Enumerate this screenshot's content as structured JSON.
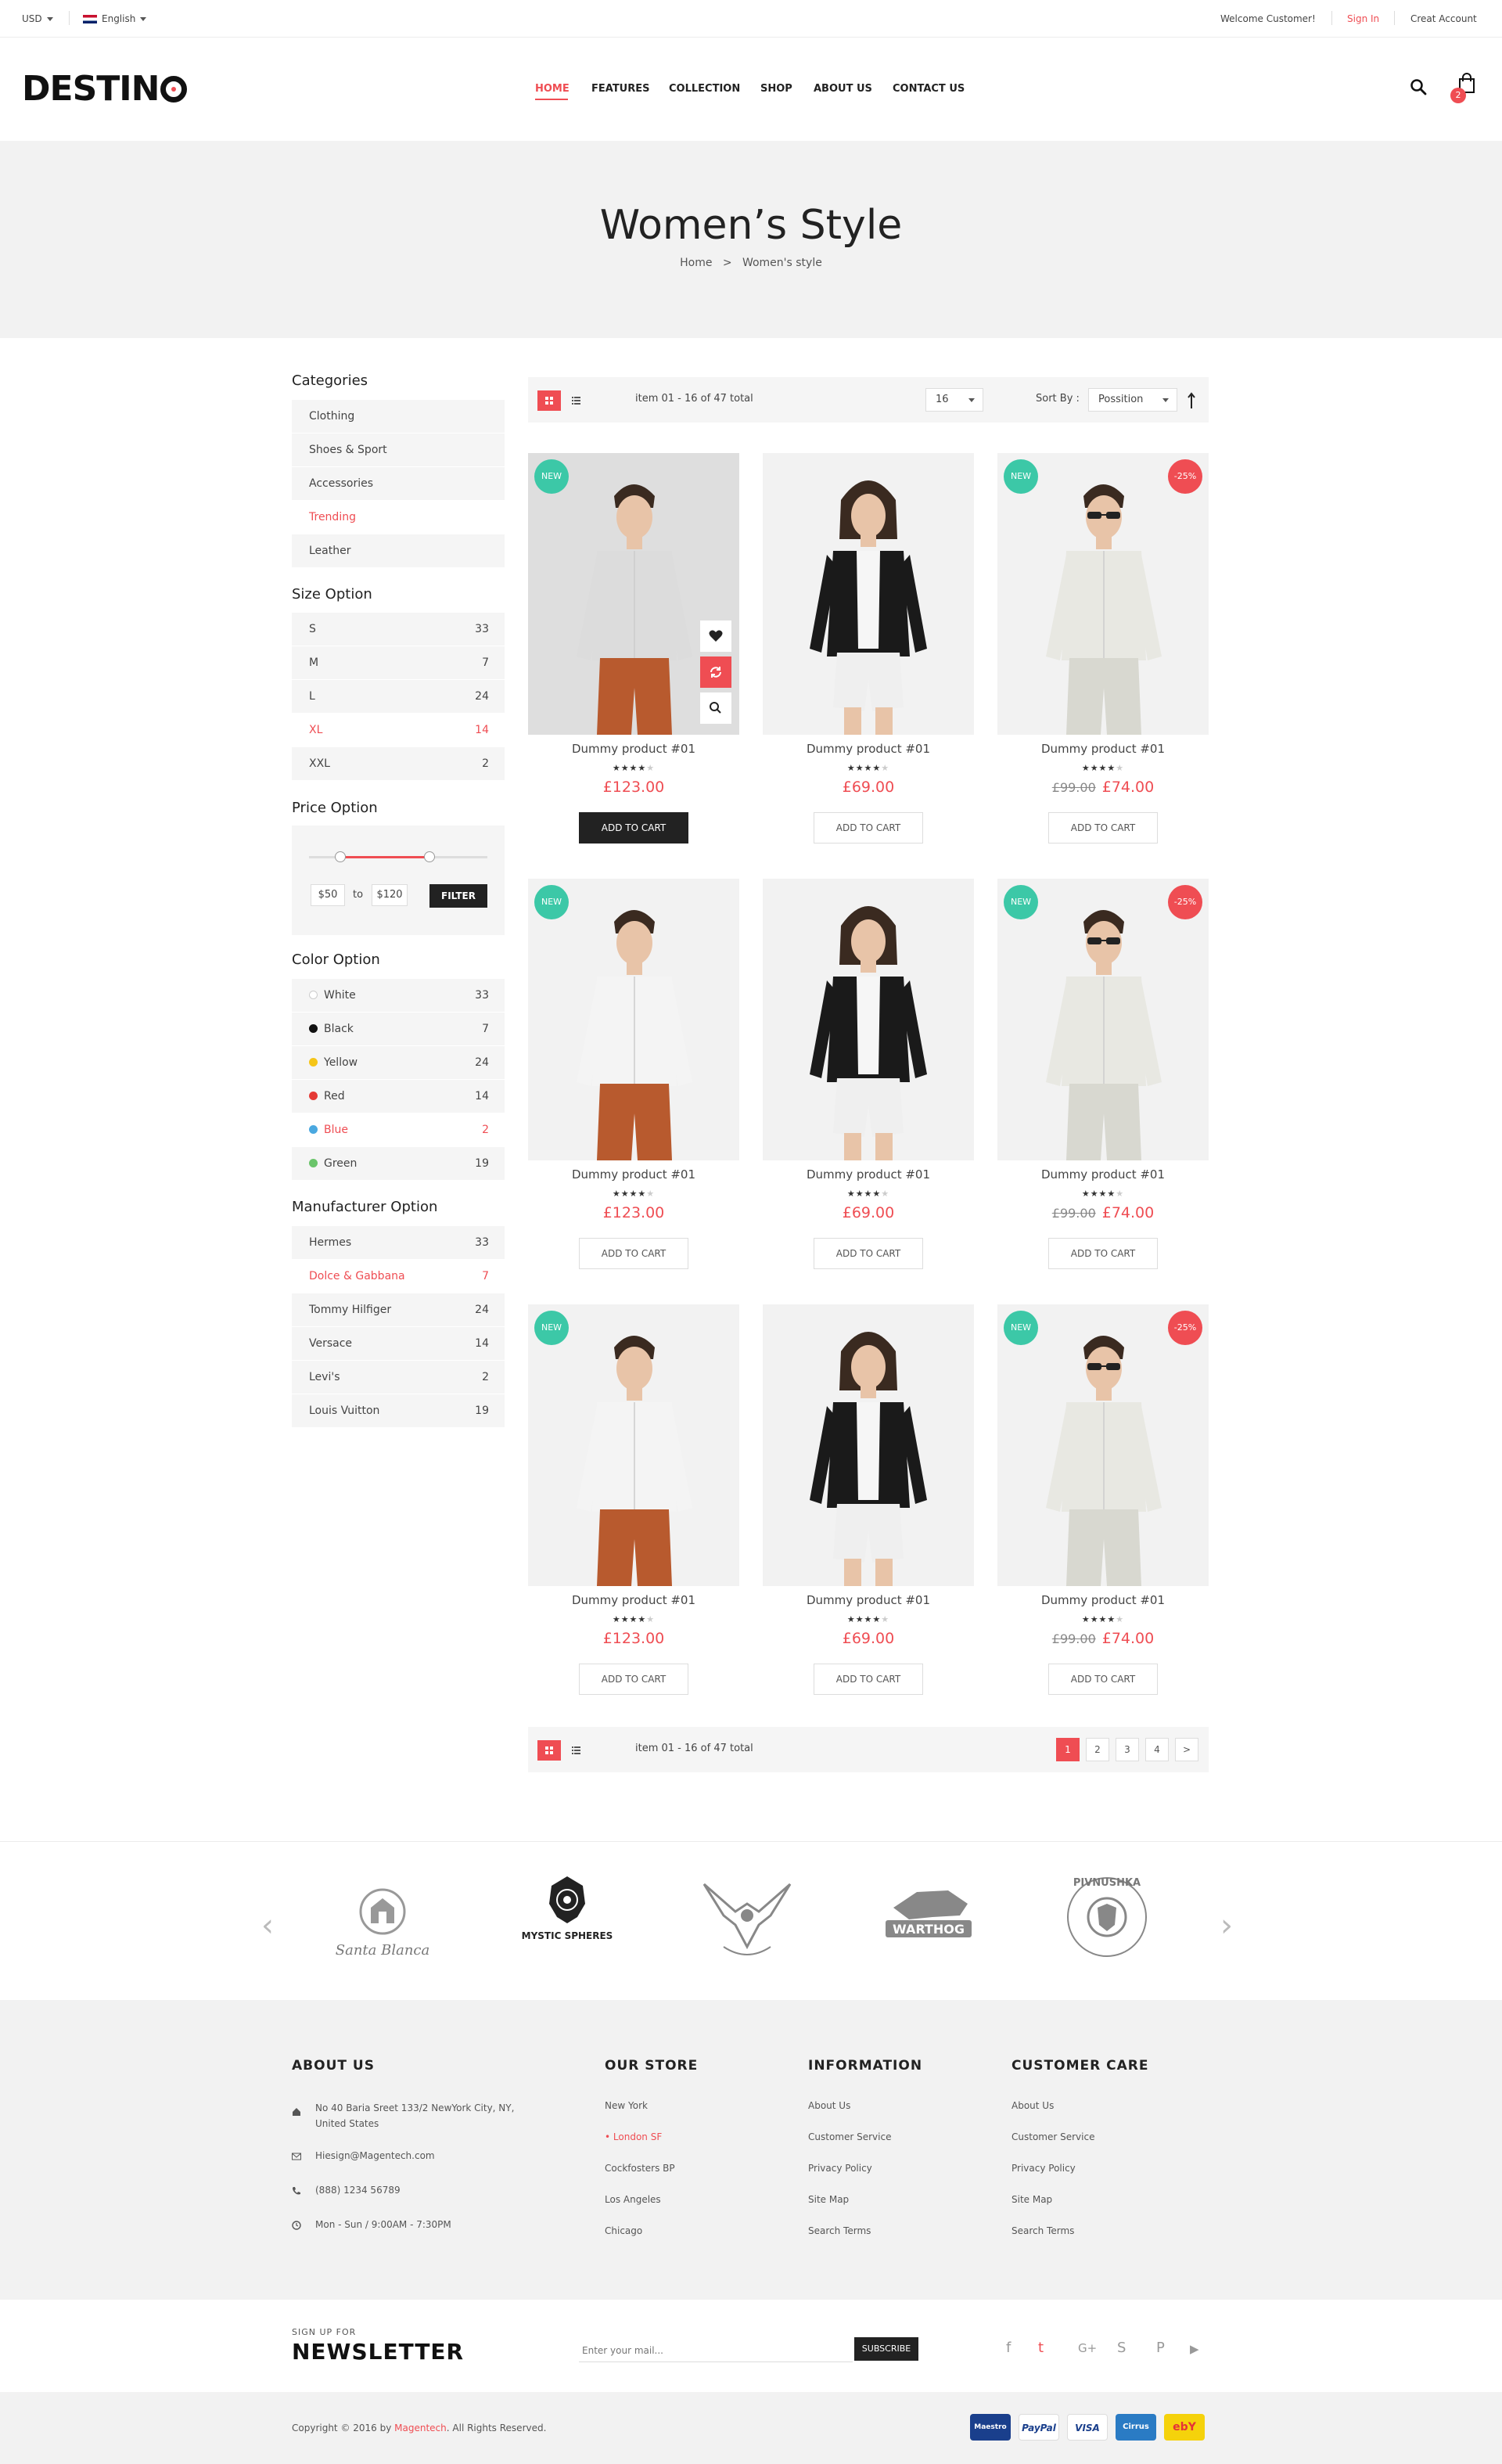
{
  "topbar": {
    "currency": "USD",
    "language": "English",
    "welcome": "Welcome Customer!",
    "sign_in": "Sign In",
    "create_account": "Creat Account"
  },
  "header": {
    "logo": "DESTINO",
    "nav": [
      "HOME",
      "FEATURES",
      "COLLECTION",
      "SHOP",
      "ABOUT US",
      "CONTACT US"
    ],
    "cart_count": "2"
  },
  "hero": {
    "title": "Women’s Style",
    "breadcrumb": [
      "Home",
      ">",
      "Women's style"
    ]
  },
  "sidebar": {
    "categories": {
      "title": "Categories",
      "items": [
        "Clothing",
        "Shoes & Sport",
        "Accessories",
        "Trending",
        "Leather"
      ],
      "active": "Trending"
    },
    "size": {
      "title": "Size Option",
      "items": [
        {
          "label": "S",
          "count": "33"
        },
        {
          "label": "M",
          "count": "7"
        },
        {
          "label": "L",
          "count": "24"
        },
        {
          "label": "XL",
          "count": "14"
        },
        {
          "label": "XXL",
          "count": "2"
        }
      ],
      "active": "XL"
    },
    "price": {
      "title": "Price Option",
      "min": "$50",
      "to": "to",
      "max": "$120",
      "filter": "FILTER"
    },
    "color": {
      "title": "Color Option",
      "items": [
        {
          "label": "White",
          "count": "33",
          "hex": "#ffffff"
        },
        {
          "label": "Black",
          "count": "7",
          "hex": "#111111"
        },
        {
          "label": "Yellow",
          "count": "24",
          "hex": "#f5c518"
        },
        {
          "label": "Red",
          "count": "14",
          "hex": "#e53935"
        },
        {
          "label": "Blue",
          "count": "2",
          "hex": "#4aa8e0"
        },
        {
          "label": "Green",
          "count": "19",
          "hex": "#6ac46a"
        }
      ],
      "active": "Blue"
    },
    "manufacturer": {
      "title": "Manufacturer Option",
      "items": [
        {
          "label": "Hermes",
          "count": "33"
        },
        {
          "label": "Dolce & Gabbana",
          "count": "7"
        },
        {
          "label": "Tommy Hilfiger",
          "count": "24"
        },
        {
          "label": "Versace",
          "count": "14"
        },
        {
          "label": "Levi's",
          "count": "2"
        },
        {
          "label": "Louis Vuitton",
          "count": "19"
        }
      ],
      "active": "Dolce & Gabbana"
    }
  },
  "toolbar": {
    "item_count": "item 01 - 16 of 47 total",
    "per_page": "16",
    "sort_label": "Sort By :",
    "sort_value": "Possition"
  },
  "products": [
    {
      "name": "Dummy product #01",
      "price": "£123.00",
      "old_price": "",
      "badge": "NEW",
      "sale": "",
      "rating": 4,
      "cart": "ADD TO CART",
      "figure": "man-shirt-dark"
    },
    {
      "name": "Dummy product #01",
      "price": "£69.00",
      "old_price": "",
      "badge": "",
      "sale": "",
      "rating": 4,
      "cart": "ADD TO CART",
      "figure": "woman-jacket"
    },
    {
      "name": "Dummy product #01",
      "price": "£74.00",
      "old_price": "£99.00",
      "badge": "NEW",
      "sale": "-25%",
      "rating": 4,
      "cart": "ADD TO CART",
      "figure": "man-sunglasses"
    },
    {
      "name": "Dummy product #01",
      "price": "£123.00",
      "old_price": "",
      "badge": "NEW",
      "sale": "",
      "rating": 4,
      "cart": "ADD TO CART",
      "figure": "man-shirt"
    },
    {
      "name": "Dummy product #01",
      "price": "£69.00",
      "old_price": "",
      "badge": "",
      "sale": "",
      "rating": 4,
      "cart": "ADD TO CART",
      "figure": "woman-jacket"
    },
    {
      "name": "Dummy product #01",
      "price": "£74.00",
      "old_price": "£99.00",
      "badge": "NEW",
      "sale": "-25%",
      "rating": 4,
      "cart": "ADD TO CART",
      "figure": "man-sunglasses"
    },
    {
      "name": "Dummy product #01",
      "price": "£123.00",
      "old_price": "",
      "badge": "NEW",
      "sale": "",
      "rating": 4,
      "cart": "ADD TO CART",
      "figure": "man-shirt"
    },
    {
      "name": "Dummy product #01",
      "price": "£69.00",
      "old_price": "",
      "badge": "",
      "sale": "",
      "rating": 4,
      "cart": "ADD TO CART",
      "figure": "woman-jacket"
    },
    {
      "name": "Dummy product #01",
      "price": "£74.00",
      "old_price": "£99.00",
      "badge": "NEW",
      "sale": "-25%",
      "rating": 4,
      "cart": "ADD TO CART",
      "figure": "man-sunglasses"
    }
  ],
  "pagination": {
    "item_count": "item 01 - 16 of 47 total",
    "pages": [
      "1",
      "2",
      "3",
      "4",
      ">"
    ],
    "active": "1"
  },
  "brands": [
    "Santa Blanca",
    "MYSTIC SPHERES",
    "",
    "WARTHOG",
    "PIVNUSHKA"
  ],
  "footer": {
    "about": {
      "title": "ABOUT US",
      "address": "No 40 Baria Sreet 133/2 NewYork City, NY,",
      "address2": "United States",
      "email": "Hiesign@Magentech.com",
      "phone": "(888) 1234 56789",
      "hours": "Mon - Sun / 9:00AM - 7:30PM"
    },
    "store": {
      "title": "OUR STORE",
      "items": [
        "New York",
        "London SF",
        "Cockfosters BP",
        "Los Angeles",
        "Chicago"
      ]
    },
    "information": {
      "title": "INFORMATION",
      "items": [
        "About Us",
        "Customer Service",
        "Privacy Policy",
        "Site Map",
        "Search Terms"
      ]
    },
    "care": {
      "title": "CUSTOMER CARE",
      "items": [
        "About Us",
        "Customer Service",
        "Privacy Policy",
        "Site Map",
        "Search Terms"
      ]
    }
  },
  "newsletter": {
    "small": "SIGN UP FOR",
    "title": "NEWSLETTER",
    "placeholder": "Enter your mail...",
    "button": "SUBSCRIBE"
  },
  "social": [
    "f",
    "t",
    "G+",
    "S",
    "P",
    "▶"
  ],
  "copyright": {
    "before": "Copyright © 2016 by ",
    "brand": "Magentech",
    "after": ". All Rights Reserved."
  },
  "payments": [
    "Maestro",
    "PayPal",
    "VISA",
    "Cirrus",
    "ebY"
  ],
  "colors": {
    "accent": "#ef4d53",
    "new_badge": "#3cc8a7"
  }
}
